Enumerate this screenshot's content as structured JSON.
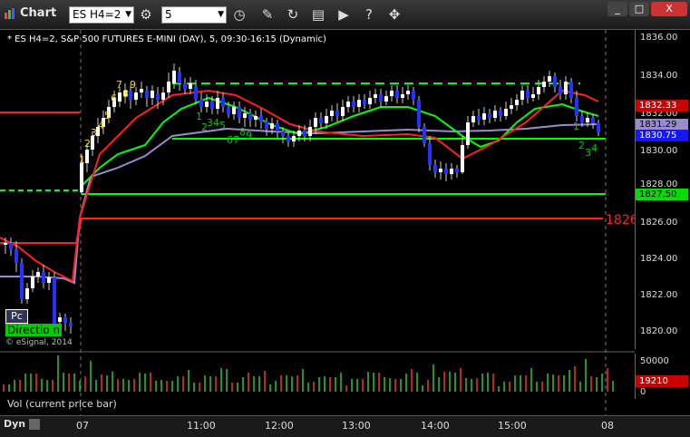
{
  "window": {
    "title": "Chart",
    "close_label": "X"
  },
  "toolbar": {
    "symbol": "ES H4=2",
    "interval": "5"
  },
  "chart_title": "* ES H4=2, S&P 500 FUTURES E-MINI (DAY), 5, 09:30-16:15 (Dynamic)",
  "y_ticks": [
    "1836.00",
    "1834.00",
    "1832.00",
    "1830.00",
    "1828.00",
    "1826.00",
    "1824.00",
    "1822.00",
    "1820.00"
  ],
  "price_labels": [
    {
      "value": "1832.33",
      "bg": "#cc0000",
      "fg": "#ffffff"
    },
    {
      "value": "1831.29",
      "bg": "#9a8ad0",
      "fg": "#000000"
    },
    {
      "value": "1830.75",
      "bg": "#1515ff",
      "fg": "#ffffff"
    },
    {
      "value": "1827.50",
      "bg": "#00dd00",
      "fg": "#000000"
    }
  ],
  "level_1826": "1826",
  "indicators": {
    "pc": "Pc",
    "direction": "Directio n",
    "credit": "© eSignal, 2014"
  },
  "volume": {
    "label": "Vol (current price bar)",
    "ticks": [
      "50000",
      "0"
    ],
    "current": "19210"
  },
  "x_ticks": [
    "07",
    "11:00",
    "12:00",
    "13:00",
    "14:00",
    "15:00",
    "08"
  ],
  "footer": {
    "dyn": "Dyn"
  },
  "counts_yellow": [
    "1",
    "2",
    "3",
    "4",
    "5",
    "6",
    "7",
    "8",
    "9"
  ],
  "counts_green": [
    "1",
    "2",
    "3",
    "4",
    "5",
    "6",
    "7",
    "8",
    "9"
  ],
  "counts_green_right": [
    "1",
    "2",
    "3",
    "4"
  ],
  "colors": {
    "support": "#00ff00",
    "resistance": "#ff2020",
    "up_bar": "#ffffff",
    "down_bar": "#2233ff",
    "ma": "#9a8ad0"
  }
}
